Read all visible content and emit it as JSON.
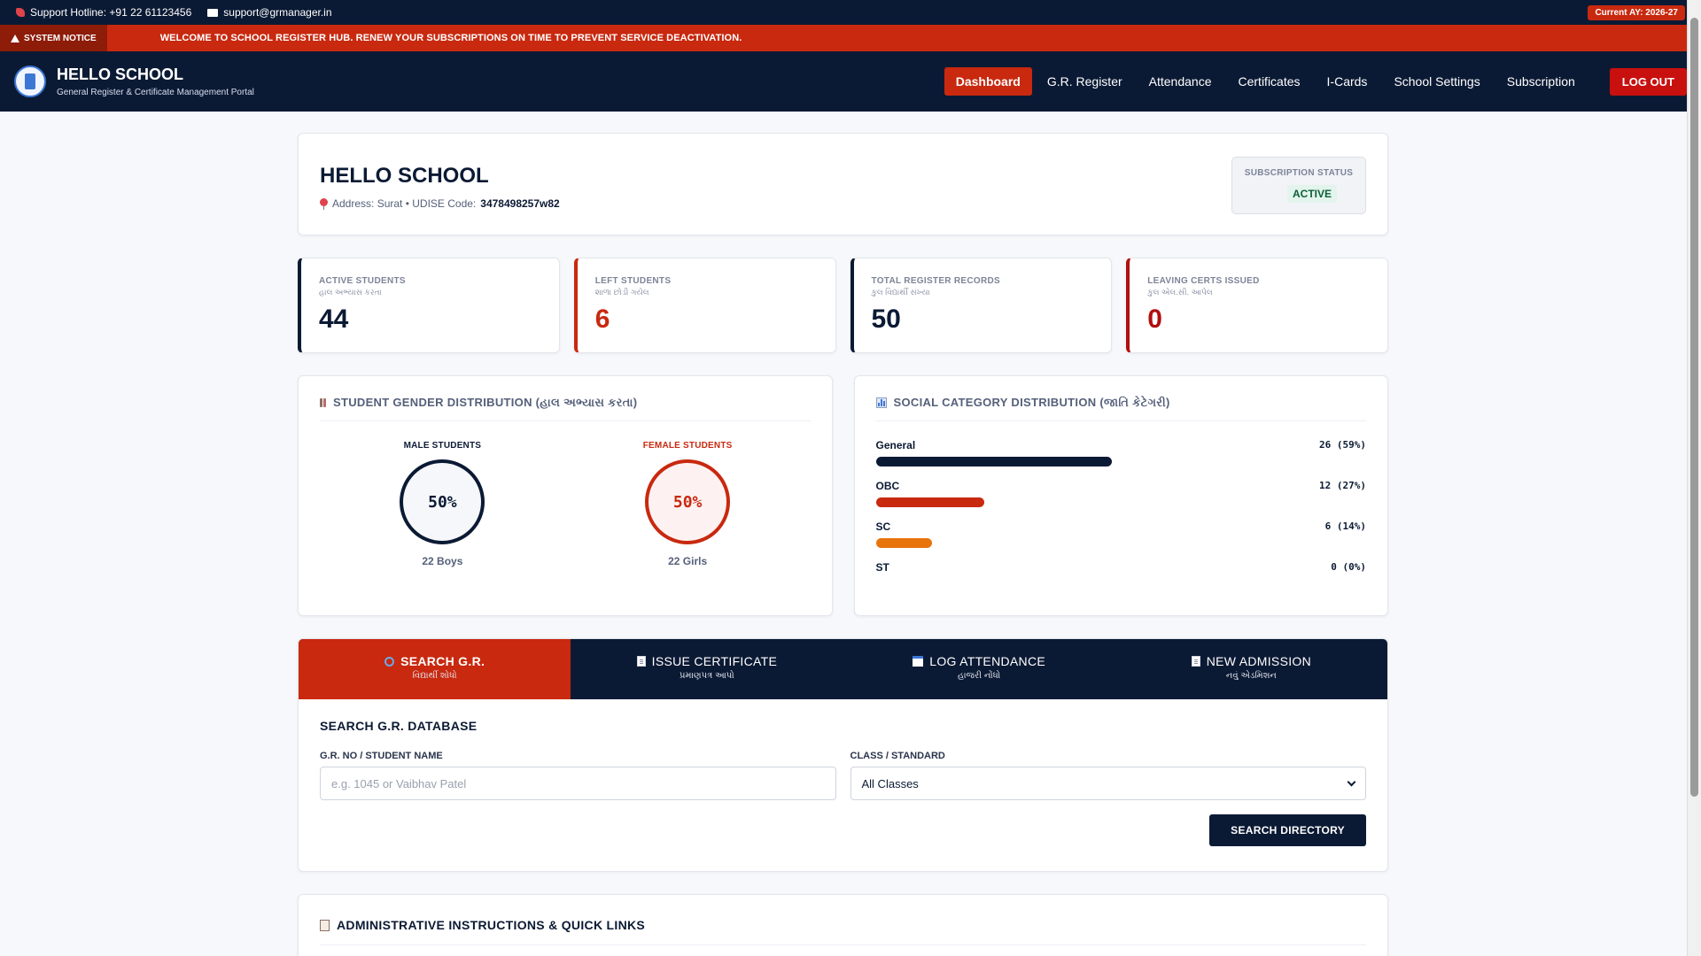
{
  "topbar": {
    "hotline": "Support Hotline: +91 22 61123456",
    "email": "support@grmanager.in",
    "academic_year": "Current AY: 2026-27"
  },
  "notice": {
    "tag": "SYSTEM NOTICE",
    "message": "WELCOME TO SCHOOL REGISTER HUB. RENEW YOUR SUBSCRIPTIONS ON TIME TO PREVENT SERVICE DEACTIVATION."
  },
  "brand": {
    "title": "HELLO SCHOOL",
    "subtitle": "General Register & Certificate Management Portal"
  },
  "nav": {
    "items": [
      "Dashboard",
      "G.R. Register",
      "Attendance",
      "Certificates",
      "I-Cards",
      "School Settings",
      "Subscription"
    ],
    "logout": "LOG OUT"
  },
  "school": {
    "name": "HELLO SCHOOL",
    "address_label": "Address: Surat • UDISE Code:",
    "udise": "3478498257w82",
    "subscription_label": "SUBSCRIPTION STATUS",
    "subscription_value": "ACTIVE"
  },
  "stats": [
    {
      "label": "ACTIVE STUDENTS",
      "gu": "હાલ અભ્યાસ કરતા",
      "value": "44"
    },
    {
      "label": "LEFT STUDENTS",
      "gu": "શાળા છોડી ગયેલ",
      "value": "6"
    },
    {
      "label": "TOTAL REGISTER RECORDS",
      "gu": "કુલ વિદ્યાર્થી સંખ્યા",
      "value": "50"
    },
    {
      "label": "LEAVING CERTS ISSUED",
      "gu": "કુલ એલ.સી. આપેલ",
      "value": "0"
    }
  ],
  "gender": {
    "title": "STUDENT GENDER DISTRIBUTION (હાલ અભ્યાસ કરતા)",
    "male_label": "MALE STUDENTS",
    "male_pct": "50%",
    "male_count": "22 Boys",
    "female_label": "FEMALE STUDENTS",
    "female_pct": "50%",
    "female_count": "22 Girls"
  },
  "social": {
    "title": "SOCIAL CATEGORY DISTRIBUTION (જાતિ કેટેગરી)",
    "categories": [
      {
        "name": "General",
        "value": "26 (59%)",
        "fraction": 0.59,
        "color": "#0b1a34"
      },
      {
        "name": "OBC",
        "value": "12 (27%)",
        "fraction": 0.27,
        "color": "#c8290f"
      },
      {
        "name": "SC",
        "value": "6 (14%)",
        "fraction": 0.14,
        "color": "#e8740c"
      },
      {
        "name": "ST",
        "value": "0 (0%)",
        "fraction": 0,
        "color": "#8a90a3"
      }
    ]
  },
  "tabs": [
    {
      "label": "SEARCH G.R.",
      "gu": "વિદ્યાર્થી શોધો"
    },
    {
      "label": "ISSUE CERTIFICATE",
      "gu": "પ્રમાણપત્ર આપો"
    },
    {
      "label": "LOG ATTENDANCE",
      "gu": "હાજરી નોંધો"
    },
    {
      "label": "NEW ADMISSION",
      "gu": "નવું એડમિશન"
    }
  ],
  "search": {
    "title": "SEARCH G.R. DATABASE",
    "name_label": "G.R. NO / STUDENT NAME",
    "name_placeholder": "e.g. 1045 or Vaibhav Patel",
    "class_label": "CLASS / STANDARD",
    "class_value": "All Classes",
    "button": "SEARCH DIRECTORY"
  },
  "admin": {
    "title": "ADMINISTRATIVE INSTRUCTIONS & QUICK LINKS"
  }
}
